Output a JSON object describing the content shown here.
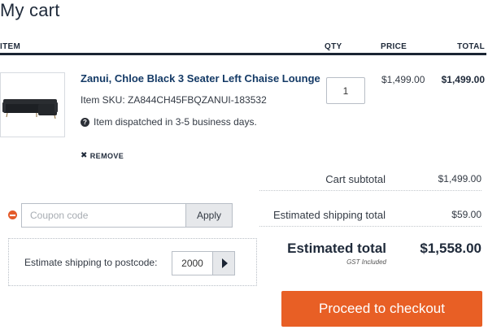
{
  "page": {
    "title": "My cart"
  },
  "table_header": {
    "item": "ITEM",
    "qty": "QTY",
    "price": "PRICE",
    "total": "TOTAL"
  },
  "item": {
    "name": "Zanui, Chloe Black 3 Seater Left Chaise Lounge",
    "sku": "Item SKU: ZA844CH45FBQZANUI-183532",
    "dispatch": "Item dispatched in 3-5 business days.",
    "dispatch_icon": "?",
    "remove_icon": "✖",
    "remove_label": "REMOVE",
    "quantity": "1",
    "unit_price": "$1,499.00",
    "line_total": "$1,499.00"
  },
  "summary": {
    "subtotal_label": "Cart subtotal",
    "subtotal_value": "$1,499.00",
    "shipping_label": "Estimated shipping total",
    "shipping_value": "$59.00",
    "total_label": "Estimated total",
    "total_note": "GST Included",
    "total_value": "$1,558.00"
  },
  "coupon": {
    "placeholder": "Coupon code",
    "apply_label": "Apply"
  },
  "shipping_estimate": {
    "label": "Estimate shipping to postcode:",
    "postcode": "2000"
  },
  "checkout": {
    "label": "Proceed to checkout"
  },
  "colors": {
    "heading": "#1f2a3a",
    "product_link": "#143a66",
    "checkout_button": "#e85f25",
    "remove_coupon_icon": "#e45b2b"
  }
}
